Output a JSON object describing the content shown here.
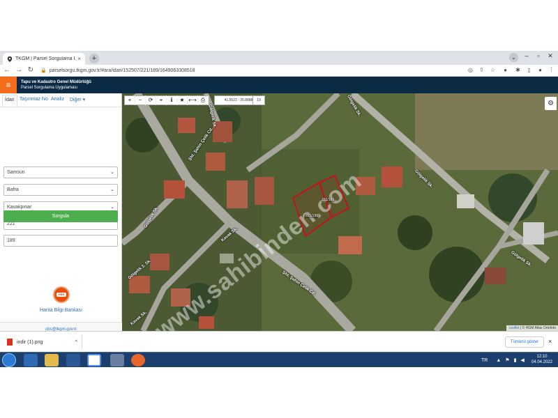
{
  "browser": {
    "tab_title": "TKGM | Parsel Sorgulama Uygula...",
    "tab_close": "×",
    "new_tab": "+",
    "url": "parselsorgu.tkgm.gov.tr/#ara/idari/152507/221/189/1649063308518"
  },
  "app": {
    "org_name": "Tapu ve Kadastro Genel Müdürlüğü",
    "app_name": "Parsel Sorgulama Uygulaması"
  },
  "panel": {
    "tabs": [
      "İdari",
      "Taşınmaz No",
      "Analiz",
      "Diğer ▾"
    ],
    "province": "Samsun",
    "district": "Bafra",
    "neighborhood": "Kavakpınar",
    "block": "221",
    "parcel": "189",
    "query_button": "Sorgula",
    "hbb_logo_text": "HBB",
    "hbb_label": "Harita Bilgi Bankası",
    "contact_email": "cbs@tkgm.gov.tr"
  },
  "map": {
    "coordinates": "41.5522 - 35.8888",
    "zoom": "19",
    "watermark": "www.sahibinden.com",
    "attribution_leaflet": "Leaflet",
    "attribution_rest": " | © HGM Atlas Ortofoto",
    "streets": [
      "Şht. Şahin Çelik Cd.",
      "Gölgelik Sk.",
      "Gölgelik Sk.",
      "Gölgelik 2. Sk.",
      "Kavak Sk.",
      "Kavak Sk.",
      "Gölgelik Sk.",
      "Gölgelik Sk.",
      "Gölgelik Sk.",
      "Şht. Şahin Çelik Cd."
    ],
    "parcels": [
      "221/190",
      "221/189"
    ]
  },
  "downloads": {
    "file_name": "indir (1).png",
    "show_all": "Tümünü göster",
    "close": "×"
  },
  "taskbar": {
    "language": "TR",
    "time": "12:10",
    "date": "04.04.2022"
  },
  "colors": {
    "header_bg": "#0b2a44",
    "accent_orange": "#f26c1c",
    "query_green": "#4cae4c",
    "parcel_outline": "#c4121a"
  }
}
